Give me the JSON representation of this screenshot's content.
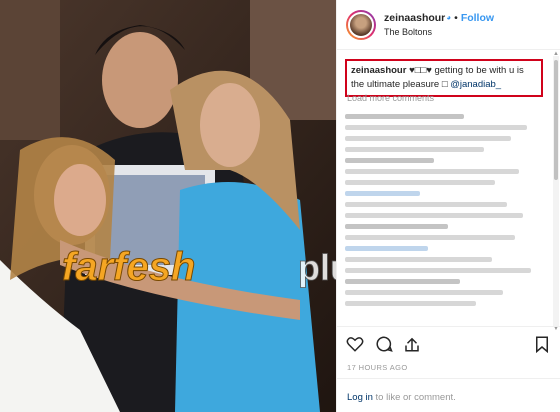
{
  "post": {
    "username": "zeinaashour",
    "verified_mark": "◕",
    "separator": "•",
    "follow_label": "Follow",
    "location": "The Boltons",
    "caption_username": "zeinaashour",
    "caption_text": " ♥□□♥ getting to be with u is the ultimate pleasure □ ",
    "caption_mention": "@janadiab_",
    "load_more": "Load more comments",
    "timestamp": "17 HOURS AGO",
    "login_link": "Log in",
    "login_rest": " to like or comment."
  },
  "watermark": {
    "brand_main": "farfesh",
    "brand_suffix": "plus.com"
  },
  "icons": {
    "like": "heart-icon",
    "comment": "comment-icon",
    "share": "share-icon",
    "save": "bookmark-icon"
  },
  "colors": {
    "link_blue": "#3897f0",
    "highlight_red": "#d0021b",
    "watermark_orange": "#f5a623"
  }
}
